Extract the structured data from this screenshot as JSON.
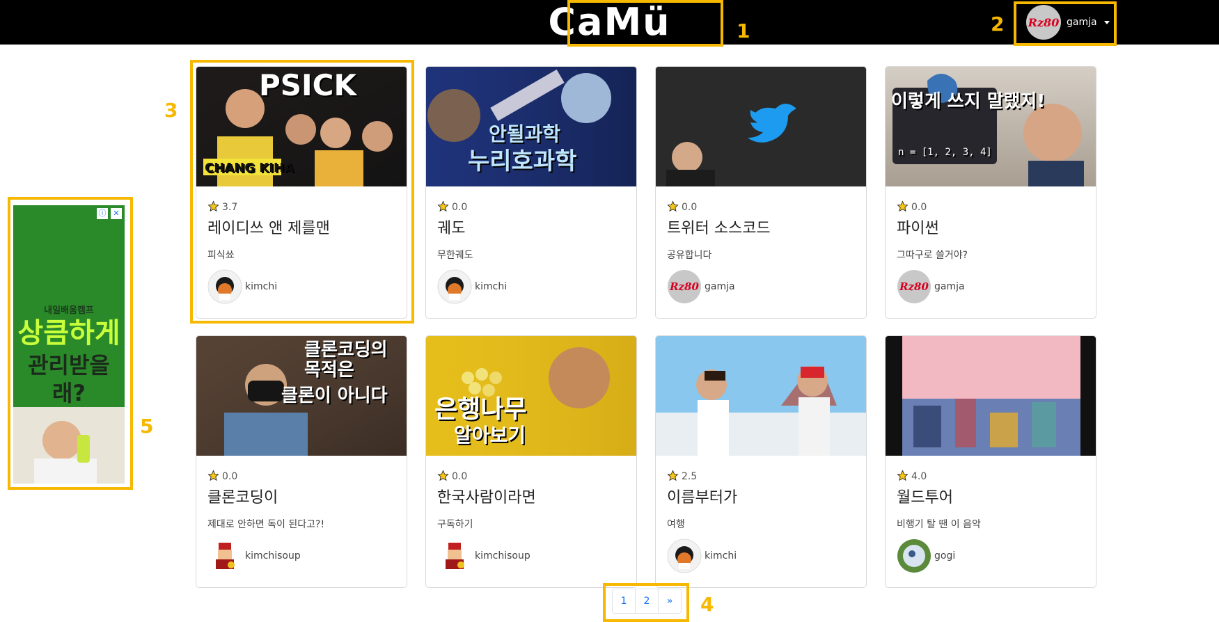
{
  "header": {
    "logo": "CaMü",
    "user_name": "gamja",
    "user_avatar_text": "Rz80"
  },
  "annotations": [
    "1",
    "2",
    "3",
    "4",
    "5"
  ],
  "cards": [
    {
      "rating": "3.7",
      "title": "레이디쓰 앤 제를맨",
      "subtitle": "피식쑈",
      "author": "kimchi",
      "thumb_text_1": "PSICK",
      "thumb_text_2": "CHANG KIHA"
    },
    {
      "rating": "0.0",
      "title": "궤도",
      "subtitle": "무한궤도",
      "author": "kimchi",
      "thumb_text_1": "안될과학",
      "thumb_text_2": "누리호과학"
    },
    {
      "rating": "0.0",
      "title": "트위터 소스코드",
      "subtitle": "공유합니다",
      "author": "gamja",
      "thumb_text_1": "",
      "thumb_text_2": ""
    },
    {
      "rating": "0.0",
      "title": "파이썬",
      "subtitle": "그따구로 쓸거야?",
      "author": "gamja",
      "thumb_text_1": "이렇게 쓰지 말랬지!",
      "thumb_text_2": "n = [1, 2, 3, 4]"
    },
    {
      "rating": "0.0",
      "title": "클론코딩이",
      "subtitle": "제대로 안하면 독이 된다고?!",
      "author": "kimchisoup",
      "thumb_text_1": "클론코딩의 목적은",
      "thumb_text_2": "클론이 아니다"
    },
    {
      "rating": "0.0",
      "title": "한국사람이라면",
      "subtitle": "구독하기",
      "author": "kimchisoup",
      "thumb_text_1": "은행나무",
      "thumb_text_2": "알아보기"
    },
    {
      "rating": "2.5",
      "title": "이름부터가",
      "subtitle": "여행",
      "author": "kimchi",
      "thumb_text_1": "",
      "thumb_text_2": ""
    },
    {
      "rating": "4.0",
      "title": "월드투어",
      "subtitle": "비행기 탈 땐 이 음악",
      "author": "gogi",
      "thumb_text_1": "",
      "thumb_text_2": ""
    }
  ],
  "ad": {
    "brand": "내일배움캠프",
    "line1": "상큼하게",
    "line2": "관리받을래?",
    "info_glyph": "ⓘ",
    "close_glyph": "✕"
  },
  "pagination": {
    "pages": [
      "1",
      "2"
    ],
    "next": "»"
  },
  "colors": {
    "accent": "#f6b800",
    "star": "#f5c518",
    "link": "#0d6efd"
  }
}
